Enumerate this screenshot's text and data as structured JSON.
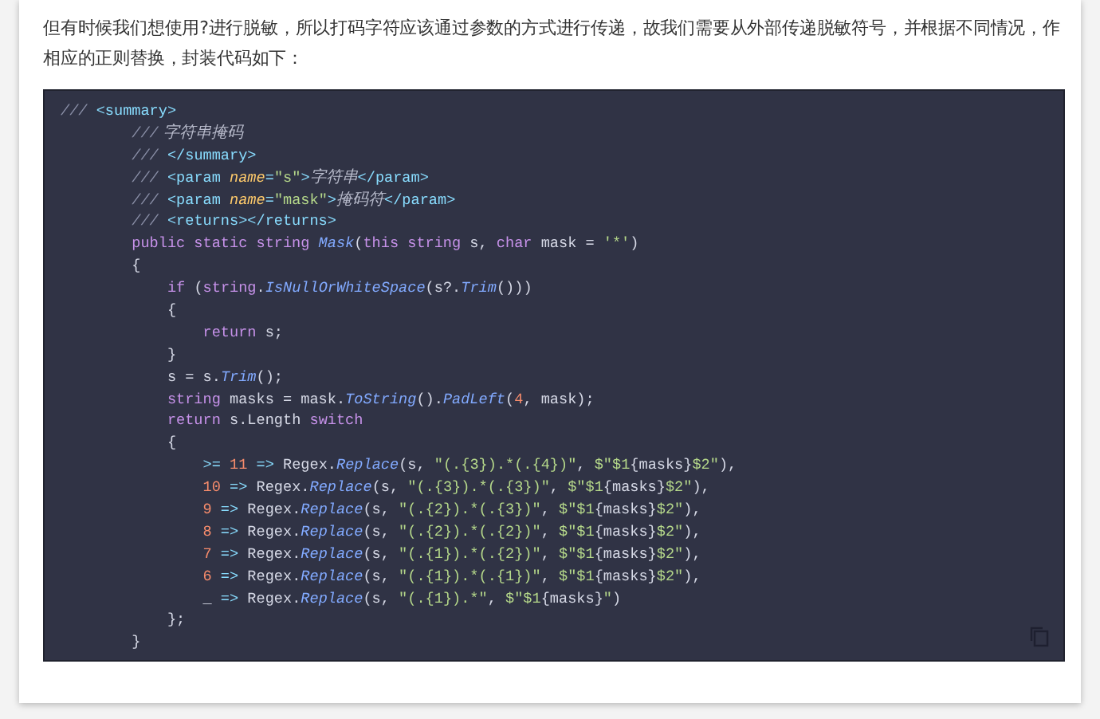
{
  "paragraph": "但有时候我们想使用?进行脱敏，所以打码字符应该通过参数的方式进行传递，故我们需要从外部传递脱敏符号，并根据不同情况，作相应的正则替换，封装代码如下：",
  "code_lines": [
    [
      {
        "kind": "comment",
        "text": "///"
      },
      {
        "kind": "tag",
        "text": " <summary>"
      }
    ],
    [
      {
        "kind": "comment",
        "text": "        ///"
      },
      {
        "kind": "doc",
        "text": " 字符串掩码"
      }
    ],
    [
      {
        "kind": "comment",
        "text": "        ///"
      },
      {
        "kind": "tag",
        "text": " </summary>"
      }
    ],
    [
      {
        "kind": "comment",
        "text": "        ///"
      },
      {
        "kind": "tag",
        "text": " <param "
      },
      {
        "kind": "attr",
        "text": "name"
      },
      {
        "kind": "tag",
        "text": "="
      },
      {
        "kind": "string",
        "text": "\"s\""
      },
      {
        "kind": "tag",
        "text": ">"
      },
      {
        "kind": "doc",
        "text": "字符串"
      },
      {
        "kind": "tag",
        "text": "</param>"
      }
    ],
    [
      {
        "kind": "comment",
        "text": "        ///"
      },
      {
        "kind": "tag",
        "text": " <param "
      },
      {
        "kind": "attr",
        "text": "name"
      },
      {
        "kind": "tag",
        "text": "="
      },
      {
        "kind": "string",
        "text": "\"mask\""
      },
      {
        "kind": "tag",
        "text": ">"
      },
      {
        "kind": "doc",
        "text": "掩码符"
      },
      {
        "kind": "tag",
        "text": "</param>"
      }
    ],
    [
      {
        "kind": "comment",
        "text": "        ///"
      },
      {
        "kind": "tag",
        "text": " <returns></returns>"
      }
    ],
    [
      {
        "kind": "keyword",
        "text": "        public static string"
      },
      {
        "kind": "method",
        "text": " Mask"
      },
      {
        "kind": "plain",
        "text": "("
      },
      {
        "kind": "keyword",
        "text": "this string"
      },
      {
        "kind": "plain",
        "text": " s, "
      },
      {
        "kind": "keyword",
        "text": "char"
      },
      {
        "kind": "plain",
        "text": " mask = "
      },
      {
        "kind": "string",
        "text": "'*'"
      },
      {
        "kind": "plain",
        "text": ")"
      }
    ],
    [
      {
        "kind": "plain",
        "text": "        {"
      }
    ],
    [
      {
        "kind": "keyword",
        "text": "            if"
      },
      {
        "kind": "plain",
        "text": " ("
      },
      {
        "kind": "keyword",
        "text": "string"
      },
      {
        "kind": "plain",
        "text": "."
      },
      {
        "kind": "method",
        "text": "IsNullOrWhiteSpace"
      },
      {
        "kind": "plain",
        "text": "(s?."
      },
      {
        "kind": "method",
        "text": "Trim"
      },
      {
        "kind": "plain",
        "text": "()))"
      }
    ],
    [
      {
        "kind": "plain",
        "text": "            {"
      }
    ],
    [
      {
        "kind": "keyword",
        "text": "                return"
      },
      {
        "kind": "plain",
        "text": " s;"
      }
    ],
    [
      {
        "kind": "plain",
        "text": "            }"
      }
    ],
    [
      {
        "kind": "plain",
        "text": "            s = s."
      },
      {
        "kind": "method",
        "text": "Trim"
      },
      {
        "kind": "plain",
        "text": "();"
      }
    ],
    [
      {
        "kind": "keyword",
        "text": "            string"
      },
      {
        "kind": "plain",
        "text": " masks = mask."
      },
      {
        "kind": "method",
        "text": "ToString"
      },
      {
        "kind": "plain",
        "text": "()."
      },
      {
        "kind": "method",
        "text": "PadLeft"
      },
      {
        "kind": "plain",
        "text": "("
      },
      {
        "kind": "number",
        "text": "4"
      },
      {
        "kind": "plain",
        "text": ", mask);"
      }
    ],
    [
      {
        "kind": "keyword",
        "text": "            return"
      },
      {
        "kind": "plain",
        "text": " s.Length "
      },
      {
        "kind": "keyword",
        "text": "switch"
      }
    ],
    [
      {
        "kind": "plain",
        "text": "            {"
      }
    ],
    [
      {
        "kind": "operator",
        "text": "                >="
      },
      {
        "kind": "number",
        "text": " 11"
      },
      {
        "kind": "operator",
        "text": " =>"
      },
      {
        "kind": "plain",
        "text": " Regex."
      },
      {
        "kind": "method",
        "text": "Replace"
      },
      {
        "kind": "plain",
        "text": "(s, "
      },
      {
        "kind": "string",
        "text": "\"(.{3}).*(.{4})\""
      },
      {
        "kind": "plain",
        "text": ", "
      },
      {
        "kind": "string",
        "text": "$\"$1"
      },
      {
        "kind": "plain",
        "text": "{masks}"
      },
      {
        "kind": "string",
        "text": "$2\""
      },
      {
        "kind": "plain",
        "text": "),"
      }
    ],
    [
      {
        "kind": "number",
        "text": "                10"
      },
      {
        "kind": "operator",
        "text": " =>"
      },
      {
        "kind": "plain",
        "text": " Regex."
      },
      {
        "kind": "method",
        "text": "Replace"
      },
      {
        "kind": "plain",
        "text": "(s, "
      },
      {
        "kind": "string",
        "text": "\"(.{3}).*(.{3})\""
      },
      {
        "kind": "plain",
        "text": ", "
      },
      {
        "kind": "string",
        "text": "$\"$1"
      },
      {
        "kind": "plain",
        "text": "{masks}"
      },
      {
        "kind": "string",
        "text": "$2\""
      },
      {
        "kind": "plain",
        "text": "),"
      }
    ],
    [
      {
        "kind": "number",
        "text": "                9"
      },
      {
        "kind": "operator",
        "text": " =>"
      },
      {
        "kind": "plain",
        "text": " Regex."
      },
      {
        "kind": "method",
        "text": "Replace"
      },
      {
        "kind": "plain",
        "text": "(s, "
      },
      {
        "kind": "string",
        "text": "\"(.{2}).*(.{3})\""
      },
      {
        "kind": "plain",
        "text": ", "
      },
      {
        "kind": "string",
        "text": "$\"$1"
      },
      {
        "kind": "plain",
        "text": "{masks}"
      },
      {
        "kind": "string",
        "text": "$2\""
      },
      {
        "kind": "plain",
        "text": "),"
      }
    ],
    [
      {
        "kind": "number",
        "text": "                8"
      },
      {
        "kind": "operator",
        "text": " =>"
      },
      {
        "kind": "plain",
        "text": " Regex."
      },
      {
        "kind": "method",
        "text": "Replace"
      },
      {
        "kind": "plain",
        "text": "(s, "
      },
      {
        "kind": "string",
        "text": "\"(.{2}).*(.{2})\""
      },
      {
        "kind": "plain",
        "text": ", "
      },
      {
        "kind": "string",
        "text": "$\"$1"
      },
      {
        "kind": "plain",
        "text": "{masks}"
      },
      {
        "kind": "string",
        "text": "$2\""
      },
      {
        "kind": "plain",
        "text": "),"
      }
    ],
    [
      {
        "kind": "number",
        "text": "                7"
      },
      {
        "kind": "operator",
        "text": " =>"
      },
      {
        "kind": "plain",
        "text": " Regex."
      },
      {
        "kind": "method",
        "text": "Replace"
      },
      {
        "kind": "plain",
        "text": "(s, "
      },
      {
        "kind": "string",
        "text": "\"(.{1}).*(.{2})\""
      },
      {
        "kind": "plain",
        "text": ", "
      },
      {
        "kind": "string",
        "text": "$\"$1"
      },
      {
        "kind": "plain",
        "text": "{masks}"
      },
      {
        "kind": "string",
        "text": "$2\""
      },
      {
        "kind": "plain",
        "text": "),"
      }
    ],
    [
      {
        "kind": "number",
        "text": "                6"
      },
      {
        "kind": "operator",
        "text": " =>"
      },
      {
        "kind": "plain",
        "text": " Regex."
      },
      {
        "kind": "method",
        "text": "Replace"
      },
      {
        "kind": "plain",
        "text": "(s, "
      },
      {
        "kind": "string",
        "text": "\"(.{1}).*(.{1})\""
      },
      {
        "kind": "plain",
        "text": ", "
      },
      {
        "kind": "string",
        "text": "$\"$1"
      },
      {
        "kind": "plain",
        "text": "{masks}"
      },
      {
        "kind": "string",
        "text": "$2\""
      },
      {
        "kind": "plain",
        "text": "),"
      }
    ],
    [
      {
        "kind": "plain",
        "text": "                _"
      },
      {
        "kind": "operator",
        "text": " =>"
      },
      {
        "kind": "plain",
        "text": " Regex."
      },
      {
        "kind": "method",
        "text": "Replace"
      },
      {
        "kind": "plain",
        "text": "(s, "
      },
      {
        "kind": "string",
        "text": "\"(.{1}).*\""
      },
      {
        "kind": "plain",
        "text": ", "
      },
      {
        "kind": "string",
        "text": "$\"$1"
      },
      {
        "kind": "plain",
        "text": "{masks}"
      },
      {
        "kind": "string",
        "text": "\""
      },
      {
        "kind": "plain",
        "text": ")"
      }
    ],
    [
      {
        "kind": "plain",
        "text": "            };"
      }
    ],
    [
      {
        "kind": "plain",
        "text": "        }"
      }
    ]
  ]
}
